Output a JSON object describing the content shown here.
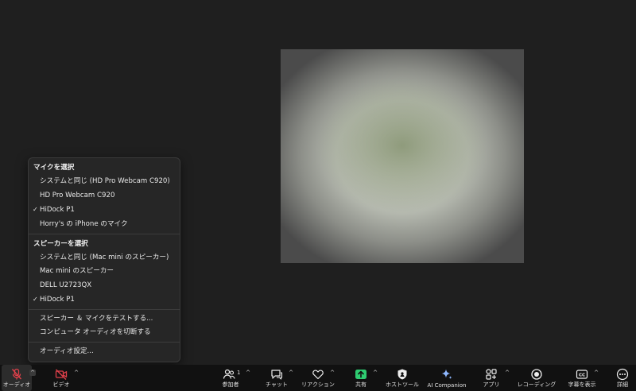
{
  "audio_menu": {
    "mic_title": "マイクを選択",
    "mic_items": [
      {
        "label": "システムと同じ (HD Pro Webcam C920)",
        "checked": false
      },
      {
        "label": "HD Pro Webcam C920",
        "checked": false
      },
      {
        "label": "HiDock P1",
        "checked": true
      },
      {
        "label": "Horry's の iPhone のマイク",
        "checked": false
      }
    ],
    "speaker_title": "スピーカーを選択",
    "speaker_items": [
      {
        "label": "システムと同じ (Mac mini のスピーカー)",
        "checked": false
      },
      {
        "label": "Mac mini のスピーカー",
        "checked": false
      },
      {
        "label": "DELL U2723QX",
        "checked": false
      },
      {
        "label": "HiDock P1",
        "checked": true
      }
    ],
    "test_label": "スピーカー ＆ マイクをテストする...",
    "switch_label": "コンピュータ オーディオを切断する",
    "settings_label": "オーディオ設定...",
    "check_glyph": "✓"
  },
  "toolbar": {
    "audio": "オーディオ",
    "video": "ビデオ",
    "participants": "参加者",
    "participants_count": "1",
    "chat": "チャット",
    "reactions": "リアクション",
    "share": "共有",
    "host_tools": "ホストツール",
    "ai_companion": "AI Companion",
    "apps": "アプリ",
    "recording": "レコーディング",
    "captions": "字幕を表示",
    "more": "詳細",
    "caret": "^"
  },
  "colors": {
    "mic_muted": "#e0404a",
    "share_green": "#2ecc71"
  }
}
